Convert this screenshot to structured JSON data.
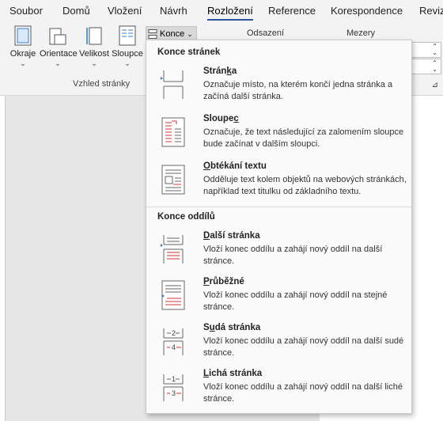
{
  "tabs": [
    {
      "label": "Soubor"
    },
    {
      "label": "Domů"
    },
    {
      "label": "Vložení"
    },
    {
      "label": "Návrh"
    },
    {
      "label": "Rozložení"
    },
    {
      "label": "Reference"
    },
    {
      "label": "Korespondence"
    },
    {
      "label": "Reviz"
    }
  ],
  "ribbon": {
    "buttons": [
      {
        "label": "Okraje"
      },
      {
        "label": "Orientace"
      },
      {
        "label": "Velikost"
      },
      {
        "label": "Sloupce"
      }
    ],
    "group_label": "Vzhled stránky",
    "konce_label": "Konce",
    "odsazeni_label": "Odsazení",
    "mezery_label": "Mezery"
  },
  "menu": {
    "section_page": "Konce stránek",
    "section_sections": "Konce oddílů",
    "items": [
      {
        "title_pre": "Strán",
        "title_u": "k",
        "title_post": "a",
        "desc": "Označuje místo, na kterém končí jedna stránka a začíná další stránka."
      },
      {
        "title_pre": "Sloupe",
        "title_u": "c",
        "title_post": "",
        "desc": "Označuje, že text následující za zalomením sloupce bude začínat v dalším sloupci."
      },
      {
        "title_pre": "",
        "title_u": "O",
        "title_post": "btékání textu",
        "desc": "Odděluje text kolem objektů na webových stránkách, například text titulku od základního textu."
      },
      {
        "title_pre": "",
        "title_u": "D",
        "title_post": "alší stránka",
        "desc": "Vloží konec oddílu a zahájí nový oddíl na další stránce."
      },
      {
        "title_pre": "",
        "title_u": "P",
        "title_post": "růběžné",
        "desc": "Vloží konec oddílu a zahájí nový oddíl na stejné stránce."
      },
      {
        "title_pre": "S",
        "title_u": "u",
        "title_post": "dá stránka",
        "desc": "Vloží konec oddílu a zahájí nový oddíl na další sudé stránce."
      },
      {
        "title_pre": "",
        "title_u": "L",
        "title_post": "ichá stránka",
        "desc": "Vloží konec oddílu a zahájí nový oddíl na další liché stránce."
      }
    ],
    "icon_glyphs": {
      "even_top": "2",
      "even_bottom": "4",
      "odd_top": "1",
      "odd_bottom": "3"
    }
  },
  "colors": {
    "accent": "#2b579a",
    "break_red": "#d13438",
    "icon_blue": "#2b7cd3"
  }
}
